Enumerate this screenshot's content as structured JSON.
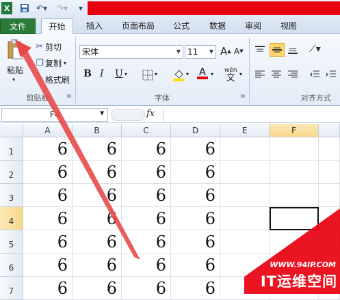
{
  "tabs": [
    "文件",
    "开始",
    "插入",
    "页面布局",
    "公式",
    "数据",
    "审阅",
    "视图"
  ],
  "clipboard": {
    "paste": "粘贴",
    "cut": "剪切",
    "copy": "复制",
    "format_painter": "格式刷",
    "label": "剪贴板"
  },
  "font": {
    "name": "宋体",
    "size": "11",
    "label": "字体",
    "bold": "B",
    "italic": "I",
    "underline": "U",
    "grow": "A",
    "shrink": "A",
    "color_a": "A",
    "wen": "wén"
  },
  "align": {
    "label": "对齐方式"
  },
  "formula": {
    "namebox": "F4",
    "fx": "fx"
  },
  "grid": {
    "columns": [
      "A",
      "B",
      "C",
      "D",
      "E",
      "F"
    ],
    "rows": [
      "1",
      "2",
      "3",
      "4",
      "5",
      "6",
      "7"
    ],
    "values": [
      [
        "6",
        "6",
        "6",
        "6",
        "",
        ""
      ],
      [
        "6",
        "6",
        "6",
        "6",
        "",
        ""
      ],
      [
        "6",
        "6",
        "6",
        "6",
        "",
        ""
      ],
      [
        "6",
        "6",
        "6",
        "6",
        "",
        ""
      ],
      [
        "6",
        "6",
        "6",
        "6",
        "",
        ""
      ],
      [
        "6",
        "6",
        "6",
        "6",
        "",
        ""
      ],
      [
        "6",
        "6",
        "6",
        "6",
        "",
        ""
      ]
    ],
    "selected_cell": "F4"
  },
  "watermark": {
    "url": "WWW.94IP.COM",
    "brand": "IT运维空间"
  },
  "colors": {
    "file_tab": "#2b7a3a",
    "title_red": "#e8000f",
    "arrow": "#e84a4a",
    "watermark": "#e8000f"
  }
}
